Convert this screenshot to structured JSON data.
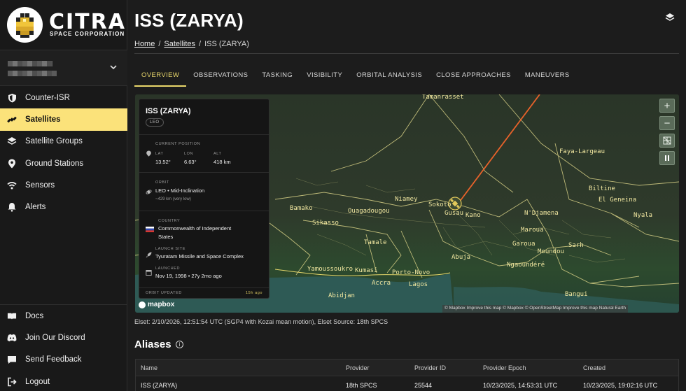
{
  "brand": {
    "name": "CITRA",
    "tagline": "SPACE CORPORATION"
  },
  "sidebar": {
    "items": [
      {
        "label": "Counter-ISR",
        "icon": "shield-icon"
      },
      {
        "label": "Satellites",
        "icon": "satellite-icon",
        "active": true
      },
      {
        "label": "Satellite Groups",
        "icon": "layers-icon"
      },
      {
        "label": "Ground Stations",
        "icon": "map-pin-icon"
      },
      {
        "label": "Sensors",
        "icon": "wifi-icon"
      },
      {
        "label": "Alerts",
        "icon": "bell-icon"
      }
    ],
    "bottom_items": [
      {
        "label": "Docs",
        "icon": "book-icon"
      },
      {
        "label": "Join Our Discord",
        "icon": "discord-icon"
      },
      {
        "label": "Send Feedback",
        "icon": "chat-icon"
      },
      {
        "label": "Logout",
        "icon": "logout-icon"
      }
    ]
  },
  "page": {
    "title": "ISS (ZARYA)",
    "breadcrumb": {
      "home": "Home",
      "satellites": "Satellites",
      "current": "ISS (ZARYA)",
      "separator": "/"
    }
  },
  "tabs": [
    "OVERVIEW",
    "OBSERVATIONS",
    "TASKING",
    "VISIBILITY",
    "ORBITAL ANALYSIS",
    "CLOSE APPROACHES",
    "MANEUVERS"
  ],
  "info_card": {
    "name": "ISS (ZARYA)",
    "badge": "LEO",
    "current_position_label": "CURRENT POSITION",
    "lat_label": "LAT",
    "lat": "13.52°",
    "lon_label": "LON",
    "lon": "6.63°",
    "alt_label": "ALT",
    "alt": "418 km",
    "orbit_label": "ORBIT",
    "orbit": "LEO • Mid-Inclination",
    "orbit_sub": "~429 km (very low)",
    "country_label": "COUNTRY",
    "country_line1": "Commonwealth of Independent",
    "country_line2": "States",
    "launch_site_label": "LAUNCH SITE",
    "launch_site": "Tyuratam Missile and Space Complex",
    "launched_label": "LAUNCHED",
    "launched": "Nov 19, 1998 • 27y 2mo ago",
    "orbit_updated_label": "ORBIT UPDATED",
    "orbit_updated": "15h ago"
  },
  "map": {
    "labels": [
      "Tamanrasset",
      "Faya-Largeau",
      "Biltine",
      "El Geneina",
      "Nyala",
      "Niamey",
      "Sokoto",
      "Gusau",
      "Kano",
      "N'Djamena",
      "Bamako",
      "Ouagadougou",
      "Sikasso",
      "Maroua",
      "Garoua",
      "Moundou",
      "Sarh",
      "Tamale",
      "Abuja",
      "Ngaoundéré",
      "Yamoussoukro",
      "Kumasi",
      "Porto-Novo",
      "Accra",
      "Lagos",
      "Abidjan",
      "Bangui"
    ],
    "controls": [
      "+",
      "−"
    ],
    "logo": "mapbox",
    "attribution": "© Mapbox Improve this map © Mapbox © OpenStreetMap Improve this map Natural Earth"
  },
  "elset": "Elset: 2/10/2026, 12:51:54 UTC (SGP4 with Kozai mean motion), Elset Source: 18th SPCS",
  "aliases": {
    "heading": "Aliases",
    "columns": [
      "Name",
      "Provider",
      "Provider ID",
      "Provider Epoch",
      "Created"
    ],
    "rows": [
      [
        "ISS (ZARYA)",
        "18th SPCS",
        "25544",
        "10/23/2025, 14:53:31 UTC",
        "10/23/2025, 19:02:16 UTC"
      ]
    ]
  },
  "colors": {
    "accent": "#fbe27a",
    "tab_active": "#e9d76b",
    "track": "#e8622a"
  }
}
